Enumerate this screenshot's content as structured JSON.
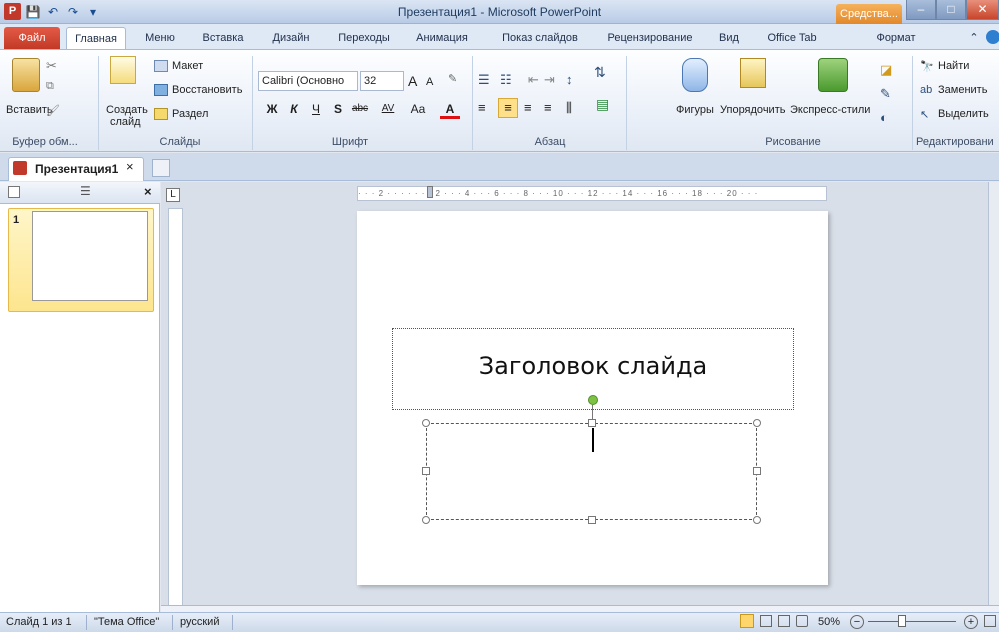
{
  "window": {
    "title": "Презентация1 - Microsoft PowerPoint",
    "tools_tab": "Средства...",
    "controls": {
      "minimize": "–",
      "maximize": "□",
      "close": "✕"
    }
  },
  "qat": {
    "logo": "P",
    "save": "💾",
    "undo": "↶",
    "redo": "↷",
    "customize": "▾"
  },
  "ribbon_tabs": [
    "Файл",
    "Главная",
    "Меню",
    "Вставка",
    "Дизайн",
    "Переходы",
    "Анимация",
    "Показ слайдов",
    "Рецензирование",
    "Вид",
    "Office Tab",
    "Формат"
  ],
  "ribbon": {
    "clipboard": {
      "paste": "Вставить",
      "label": "Буфер обм..."
    },
    "slides": {
      "new_slide_1": "Создать",
      "new_slide_2": "слайд",
      "layout": "Макет",
      "reset": "Восстановить",
      "section": "Раздел",
      "label": "Слайды"
    },
    "font": {
      "name": "Calibri (Основно",
      "size": "32",
      "grow": "A",
      "shrink": "A",
      "bold": "Ж",
      "italic": "К",
      "underline": "Ч",
      "shadow": "S",
      "strike": "abc",
      "spacing": "AV",
      "case": "Aa",
      "color": "A",
      "label": "Шрифт"
    },
    "paragraph": {
      "label": "Абзац"
    },
    "drawing": {
      "shapes": "Фигуры",
      "arrange": "Упорядочить",
      "quick_styles": "Экспресс-стили",
      "label": "Рисование"
    },
    "editing": {
      "find": "Найти",
      "replace": "Заменить",
      "select": "Выделить",
      "label": "Редактировани"
    }
  },
  "doc_tab": {
    "title": "Презентация1",
    "close": "×"
  },
  "left_panel": {
    "slide_number": "1",
    "close": "×"
  },
  "ruler": {
    "h_text": "· · · 2 · · · · · · · 2 · · · 4 · · · 6 · · · 8 · · · 10 · · · 12 · · · 14 · · · 16 · · · 18 · · · 20 · · ·"
  },
  "slide": {
    "title_placeholder": "Заголовок слайда"
  },
  "status": {
    "slide": "Слайд 1 из 1",
    "theme": "\"Тема Office\"",
    "lang": "русский",
    "zoom": "50%",
    "zoom_minus": "−",
    "zoom_plus": "+"
  },
  "colors": {
    "accent": "#c23a25",
    "ribbon": "#dfe8f5",
    "rotation_handle": "#7dc242"
  }
}
